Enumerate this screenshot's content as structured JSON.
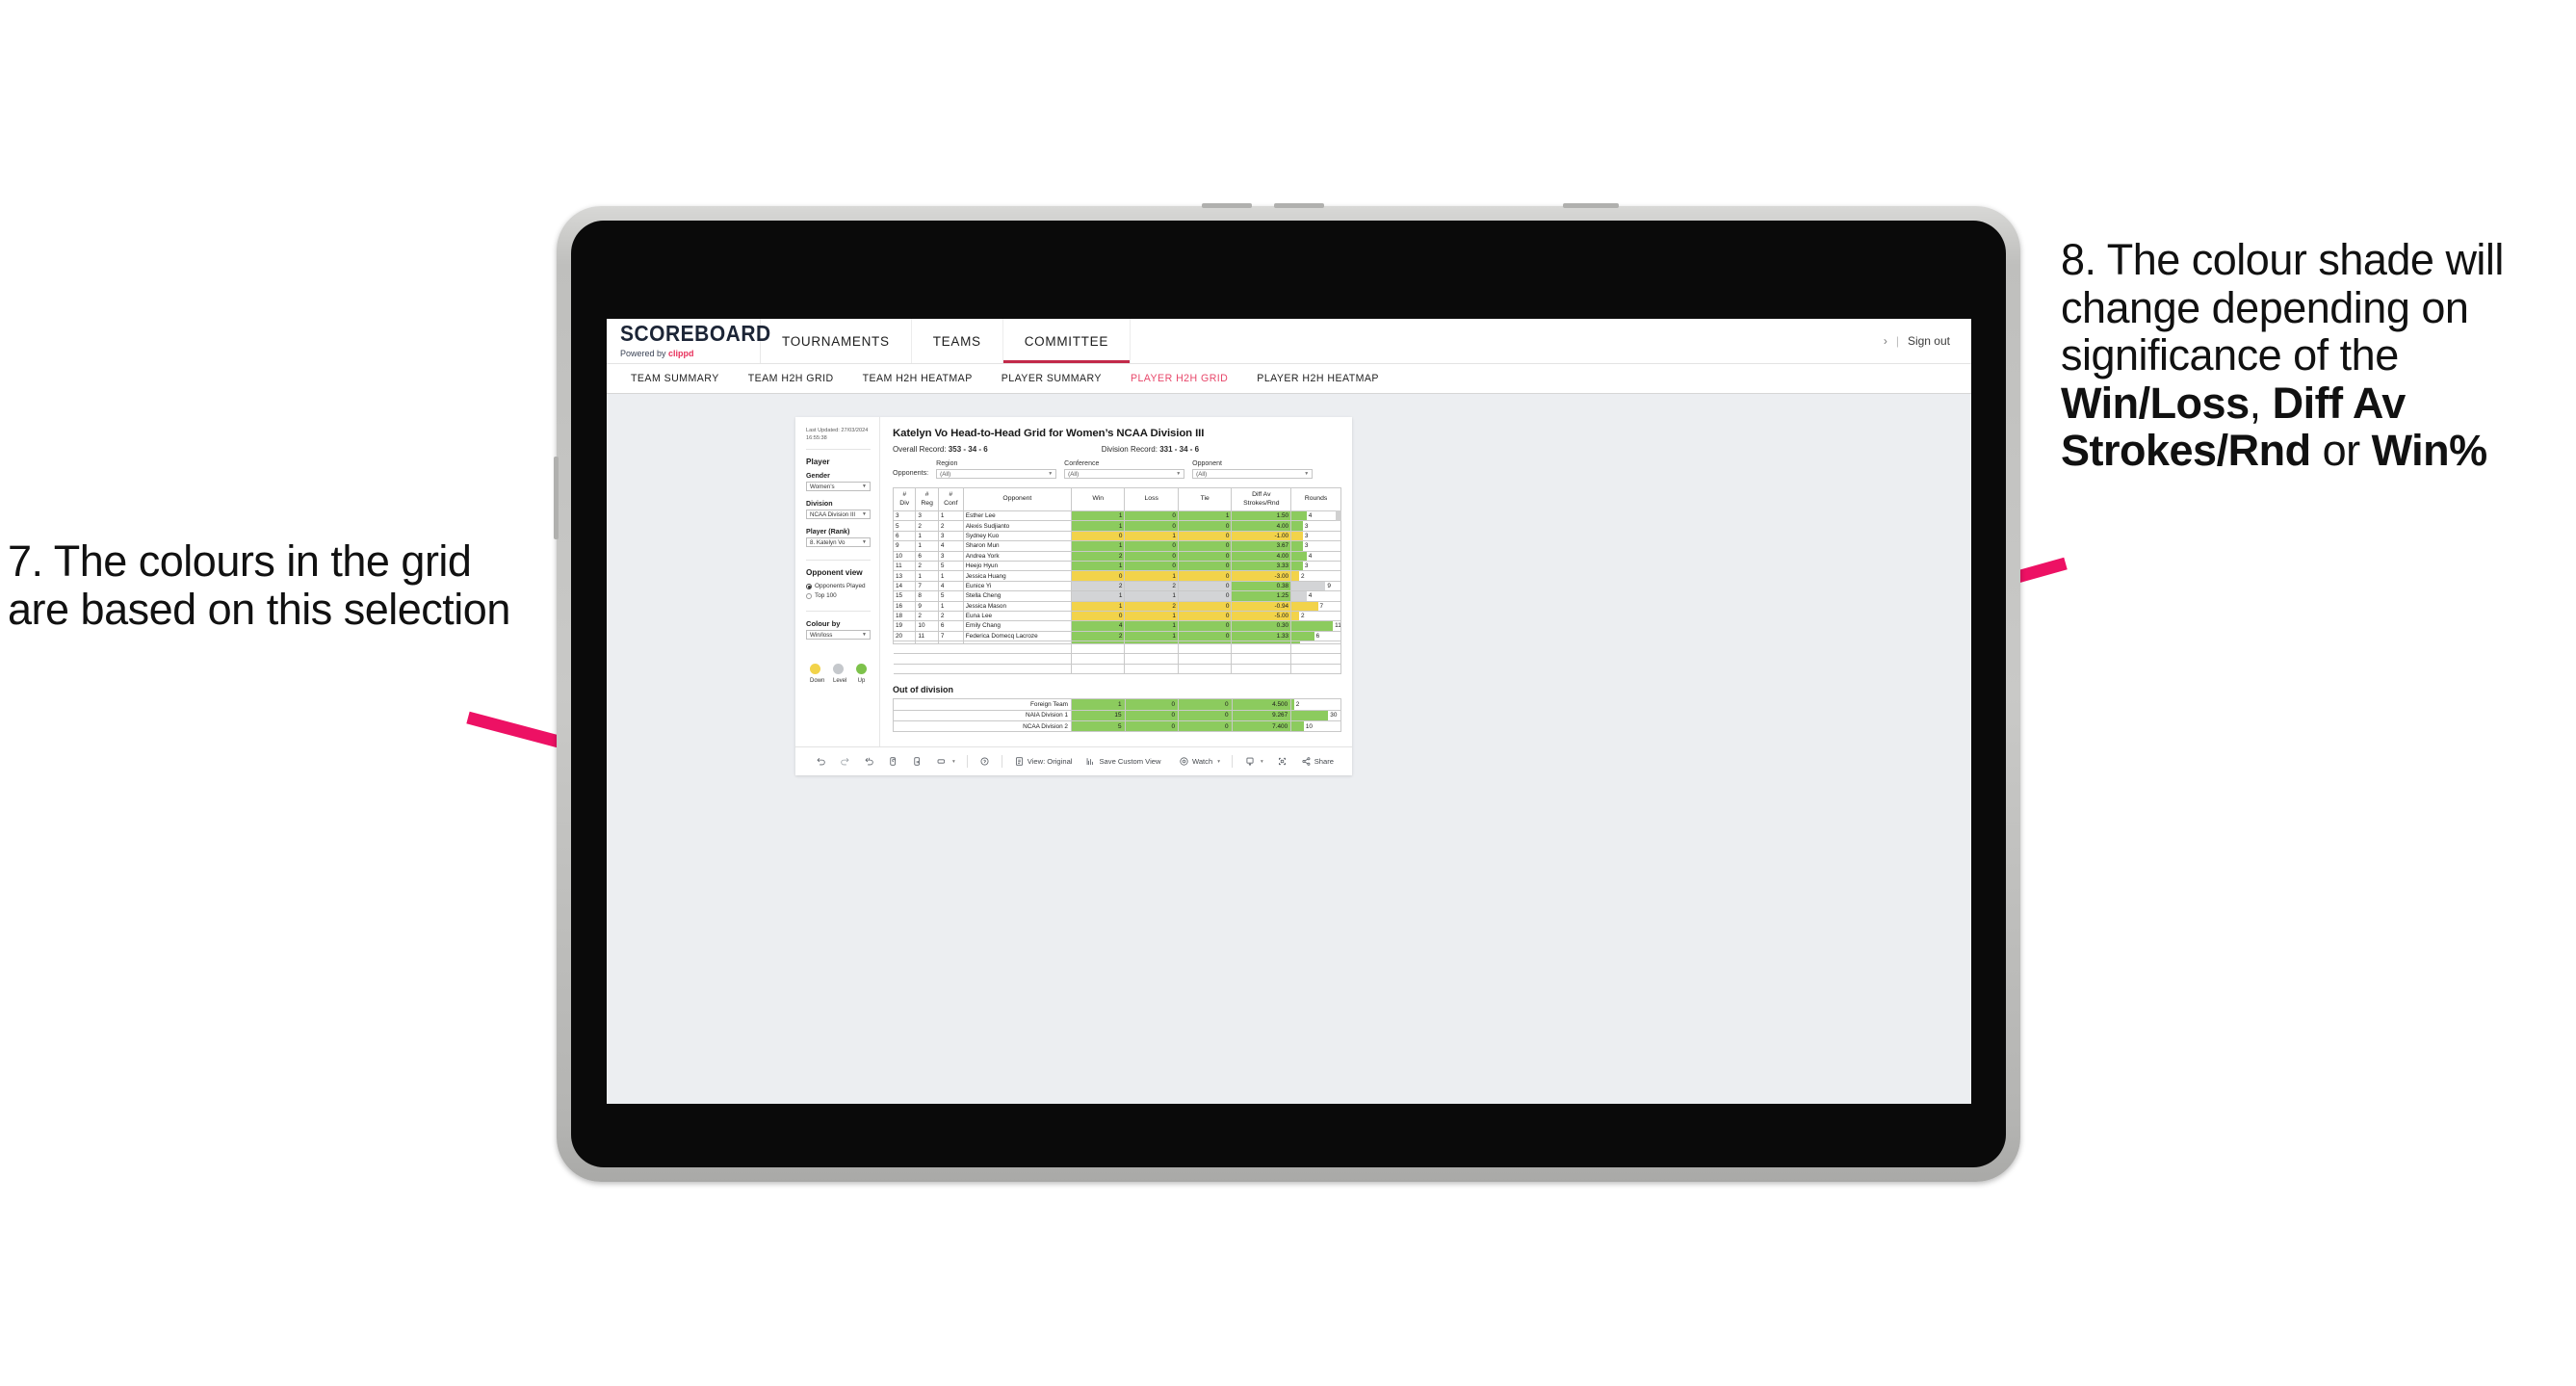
{
  "annotations": {
    "left": "7. The colours in the grid are based on this selection",
    "right_prefix": "8. The colour shade will change depending on significance of the ",
    "right_bold_1": "Win/Loss",
    "right_mid_1": ", ",
    "right_bold_2": "Diff Av Strokes/Rnd",
    "right_mid_2": " or ",
    "right_bold_3": "Win%",
    "arrow_color": "#ed1164"
  },
  "header": {
    "brand_title": "SCOREBOARD",
    "brand_powered": "Powered by ",
    "brand_clippd": "clippd",
    "nav": [
      {
        "label": "TOURNAMENTS",
        "active": false
      },
      {
        "label": "TEAMS",
        "active": false
      },
      {
        "label": "COMMITTEE",
        "active": true
      }
    ],
    "chevron": "›",
    "separator": "|",
    "sign_out": "Sign out",
    "accent": "#c22a4a"
  },
  "subnav": {
    "tabs": [
      {
        "label": "TEAM SUMMARY",
        "active": false
      },
      {
        "label": "TEAM H2H GRID",
        "active": false
      },
      {
        "label": "TEAM H2H HEATMAP",
        "active": false
      },
      {
        "label": "PLAYER SUMMARY",
        "active": false
      },
      {
        "label": "PLAYER H2H GRID",
        "active": true
      },
      {
        "label": "PLAYER H2H HEATMAP",
        "active": false
      }
    ],
    "active_color": "#e8486b"
  },
  "sidebar": {
    "last_updated_line1": "Last Updated: 27/03/2024",
    "last_updated_line2": "16:55:38",
    "player_heading": "Player",
    "fields": [
      {
        "label": "Gender",
        "value": "Women’s"
      },
      {
        "label": "Division",
        "value": "NCAA Division III"
      },
      {
        "label": "Player (Rank)",
        "value": "8. Katelyn Vo"
      }
    ],
    "opponent_view_heading": "Opponent view",
    "opponent_view_options": [
      {
        "label": "Opponents Played",
        "selected": true
      },
      {
        "label": "Top 100",
        "selected": false
      }
    ],
    "colour_by_label": "Colour by",
    "colour_by_value": "Win/loss",
    "legend": [
      {
        "label": "Down",
        "color": "#f2d34a"
      },
      {
        "label": "Level",
        "color": "#c5c8cc"
      },
      {
        "label": "Up",
        "color": "#7dc24b"
      }
    ]
  },
  "sheet": {
    "title": "Katelyn Vo Head-to-Head Grid for Women’s NCAA Division III",
    "overall_record_label": "Overall Record: ",
    "overall_record_value": "353 -  34 - 6",
    "division_record_label": "Division Record: ",
    "division_record_value": "331 -  34 - 6",
    "opponents_label": "Opponents:",
    "filters": [
      {
        "label": "Region",
        "value": "(All)"
      },
      {
        "label": "Conference",
        "value": "(All)"
      },
      {
        "label": "Opponent",
        "value": "(All)"
      }
    ]
  },
  "chart_data": {
    "type": "table",
    "title": "Katelyn Vo Head-to-Head Grid for Women’s NCAA Division III",
    "columns": [
      "# Div",
      "# Reg",
      "# Conf",
      "Opponent",
      "Win",
      "Loss",
      "Tie",
      "Diff Av Strokes/Rnd",
      "Rounds"
    ],
    "column_headers_two_line": {
      "c0_top": "#",
      "c0_bot": "Div",
      "c1_top": "#",
      "c1_bot": "Reg",
      "c2_top": "#",
      "c2_bot": "Conf",
      "c3": "Opponent",
      "c4": "Win",
      "c5": "Loss",
      "c6": "Tie",
      "c7_top": "Diff Av",
      "c7_bot": "Strokes/Rnd",
      "c8": "Rounds"
    },
    "rounds_axis_max": 13,
    "rows": [
      {
        "div": "3",
        "reg": "3",
        "conf": "1",
        "opponent": "Esther Lee",
        "win": "1",
        "loss": "0",
        "tie": "1",
        "diff": "1.50",
        "rounds": "4",
        "color": "green"
      },
      {
        "div": "5",
        "reg": "2",
        "conf": "2",
        "opponent": "Alexis Sudjianto",
        "win": "1",
        "loss": "0",
        "tie": "0",
        "diff": "4.00",
        "rounds": "3",
        "color": "green"
      },
      {
        "div": "6",
        "reg": "1",
        "conf": "3",
        "opponent": "Sydney Kuo",
        "win": "0",
        "loss": "1",
        "tie": "0",
        "diff": "-1.00",
        "rounds": "3",
        "color": "yellow"
      },
      {
        "div": "9",
        "reg": "1",
        "conf": "4",
        "opponent": "Sharon Mun",
        "win": "1",
        "loss": "0",
        "tie": "0",
        "diff": "3.67",
        "rounds": "3",
        "color": "green"
      },
      {
        "div": "10",
        "reg": "6",
        "conf": "3",
        "opponent": "Andrea York",
        "win": "2",
        "loss": "0",
        "tie": "0",
        "diff": "4.00",
        "rounds": "4",
        "color": "green"
      },
      {
        "div": "11",
        "reg": "2",
        "conf": "5",
        "opponent": "Heejo Hyun",
        "win": "1",
        "loss": "0",
        "tie": "0",
        "diff": "3.33",
        "rounds": "3",
        "color": "green"
      },
      {
        "div": "13",
        "reg": "1",
        "conf": "1",
        "opponent": "Jessica Huang",
        "win": "0",
        "loss": "1",
        "tie": "0",
        "diff": "-3.00",
        "rounds": "2",
        "color": "yellow"
      },
      {
        "div": "14",
        "reg": "7",
        "conf": "4",
        "opponent": "Eunice Yi",
        "win": "2",
        "loss": "2",
        "tie": "0",
        "diff": "0.38",
        "rounds": "9",
        "color": "grey",
        "diff_color": "green"
      },
      {
        "div": "15",
        "reg": "8",
        "conf": "5",
        "opponent": "Stella Cheng",
        "win": "1",
        "loss": "1",
        "tie": "0",
        "diff": "1.25",
        "rounds": "4",
        "color": "grey",
        "diff_color": "green"
      },
      {
        "div": "16",
        "reg": "9",
        "conf": "1",
        "opponent": "Jessica Mason",
        "win": "1",
        "loss": "2",
        "tie": "0",
        "diff": "-0.94",
        "rounds": "7",
        "color": "yellow"
      },
      {
        "div": "18",
        "reg": "2",
        "conf": "2",
        "opponent": "Euna Lee",
        "win": "0",
        "loss": "1",
        "tie": "0",
        "diff": "-5.00",
        "rounds": "2",
        "color": "yellow"
      },
      {
        "div": "19",
        "reg": "10",
        "conf": "6",
        "opponent": "Emily Chang",
        "win": "4",
        "loss": "1",
        "tie": "0",
        "diff": "0.30",
        "rounds": "11",
        "color": "green"
      },
      {
        "div": "20",
        "reg": "11",
        "conf": "7",
        "opponent": "Federica Domecq Lacroze",
        "win": "2",
        "loss": "1",
        "tie": "0",
        "diff": "1.33",
        "rounds": "6",
        "color": "green"
      }
    ],
    "colors": {
      "green": "#8ccb5e",
      "yellow": "#f2d34a",
      "grey": "#d3d4d6",
      "white": "#ffffff"
    }
  },
  "out_of_division": {
    "title": "Out of division",
    "rounds_axis_max": 40,
    "rows": [
      {
        "name": "Foreign Team",
        "win": "1",
        "loss": "0",
        "tie": "0",
        "diff": "4.500",
        "rounds": "2",
        "color": "green"
      },
      {
        "name": "NAIA Division 1",
        "win": "15",
        "loss": "0",
        "tie": "0",
        "diff": "9.267",
        "rounds": "30",
        "color": "green"
      },
      {
        "name": "NCAA Division 2",
        "win": "5",
        "loss": "0",
        "tie": "0",
        "diff": "7.400",
        "rounds": "10",
        "color": "green"
      }
    ]
  },
  "toolbar": {
    "view_label": "View: Original",
    "save_label": "Save Custom View",
    "watch_label": "Watch",
    "share_label": "Share",
    "caret": "▾"
  }
}
